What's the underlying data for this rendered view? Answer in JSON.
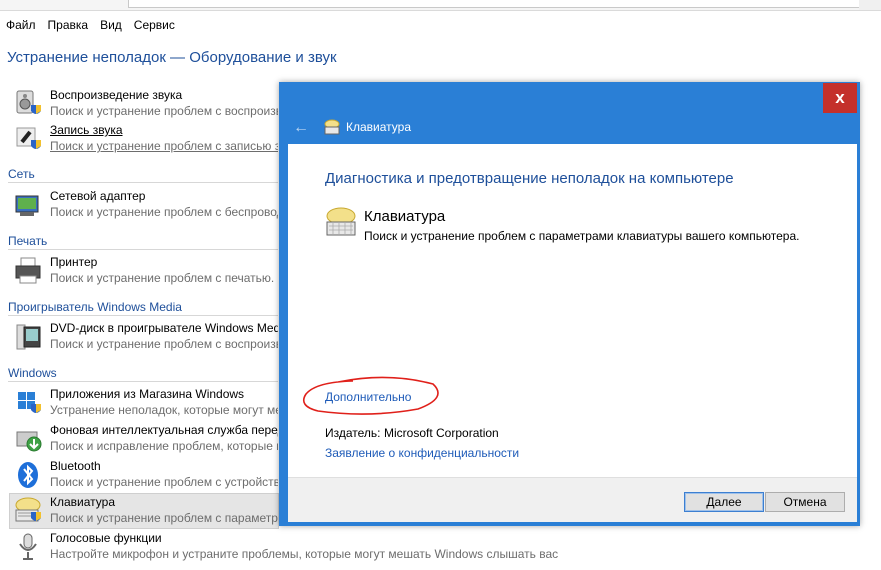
{
  "menu": [
    "Файл",
    "Правка",
    "Вид",
    "Сервис"
  ],
  "page_title": "Устранение неполадок — Оборудование и звук",
  "groups": {
    "network": "Сеть",
    "print": "Печать",
    "media": "Проигрыватель Windows Media",
    "windows": "Windows"
  },
  "items": {
    "playback": {
      "title": "Воспроизведение звука",
      "desc": "Поиск и устранение проблем с воспроизведением звука"
    },
    "recording": {
      "title": "Запись звука",
      "desc": "Поиск и устранение проблем с записью звука"
    },
    "network_adapter": {
      "title": "Сетевой адаптер",
      "desc": "Поиск и устранение проблем с беспроводными и другими сетевыми адаптерами"
    },
    "printer": {
      "title": "Принтер",
      "desc": "Поиск и устранение проблем с печатью."
    },
    "dvd": {
      "title": "DVD-диск в проигрывателе Windows Media",
      "desc": "Поиск и устранение проблем с воспроизведением DVD-дисков"
    },
    "store_apps": {
      "title": "Приложения из Магазина Windows",
      "desc": "Устранение неполадок, которые могут мешать работе приложений"
    },
    "bits": {
      "title": "Фоновая интеллектуальная служба передачи (BITS)",
      "desc": "Поиск и исправление проблем, которые могут мешать загрузке"
    },
    "bluetooth": {
      "title": "Bluetooth",
      "desc": "Поиск и устранение проблем с устройствами Bluetooth"
    },
    "keyboard": {
      "title": "Клавиатура",
      "desc": "Поиск и устранение проблем с параметрами клавиатуры"
    },
    "speech": {
      "title": "Голосовые функции",
      "desc": "Настройте микрофон и устраните проблемы, которые могут мешать Windows слышать вас"
    }
  },
  "dialog": {
    "close_symbol": "x",
    "back_symbol": "←",
    "caption": "Клавиатура",
    "heading": "Диагностика и предотвращение неполадок на компьютере",
    "tool_title": "Клавиатура",
    "tool_desc": "Поиск и устранение проблем с параметрами клавиатуры вашего компьютера.",
    "advanced_link": "Дополнительно",
    "publisher_label": "Издатель:",
    "publisher_value": "Microsoft Corporation",
    "privacy_link": "Заявление о конфиденциальности",
    "next_button": "Далее",
    "cancel_button": "Отмена"
  },
  "colors": {
    "accent_blue": "#2a7fd6",
    "link_blue": "#1e5bb8",
    "heading_blue": "#1e4f9a",
    "close_red": "#c4302b",
    "annotation_red": "#e0201a"
  }
}
